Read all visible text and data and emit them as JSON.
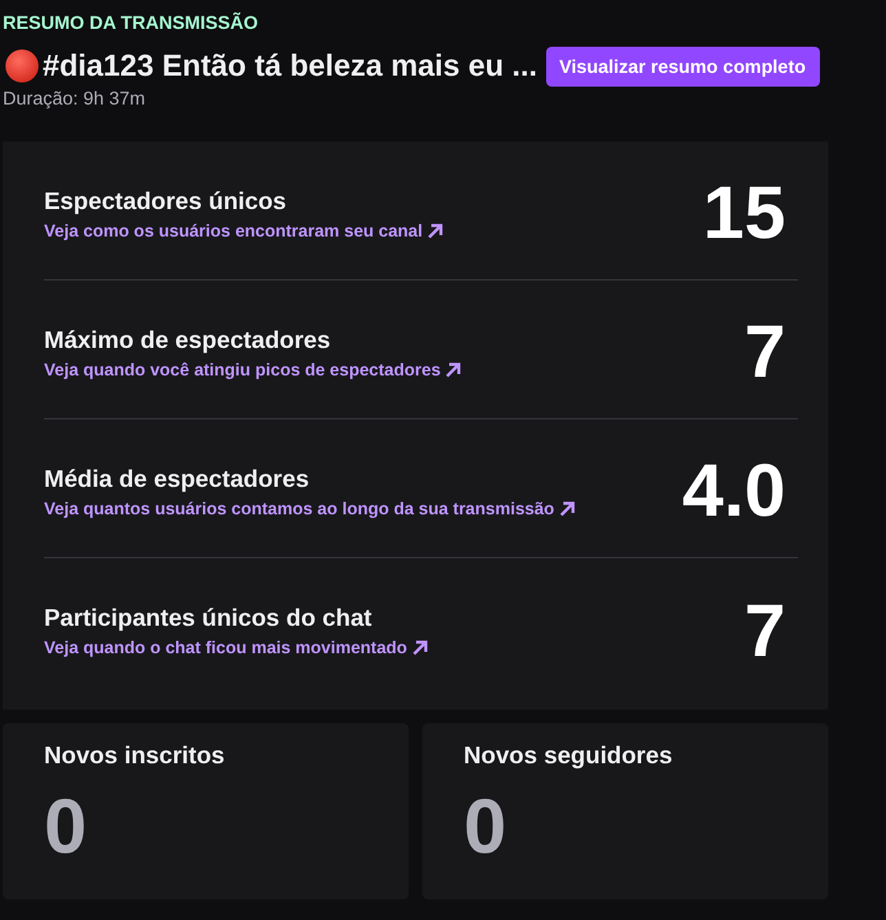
{
  "header": {
    "eyebrow": "RESUMO DA TRANSMISSÃO",
    "title": "#dia123 Então tá beleza mais eu ...",
    "button": "Visualizar resumo completo",
    "duration": "Duração: 9h 37m"
  },
  "stats": [
    {
      "label": "Espectadores únicos",
      "link": "Veja como os usuários encontraram seu canal",
      "value": "15"
    },
    {
      "label": "Máximo de espectadores",
      "link": "Veja quando você atingiu picos de espectadores",
      "value": "7"
    },
    {
      "label": "Média de espectadores",
      "link": "Veja quantos usuários contamos ao longo da sua transmissão",
      "value": "4.0"
    },
    {
      "label": "Participantes únicos do chat",
      "link": "Veja quando o chat ficou mais movimentado",
      "value": "7"
    }
  ],
  "cards": [
    {
      "label": "Novos inscritos",
      "value": "0"
    },
    {
      "label": "Novos seguidores",
      "value": "0"
    }
  ]
}
